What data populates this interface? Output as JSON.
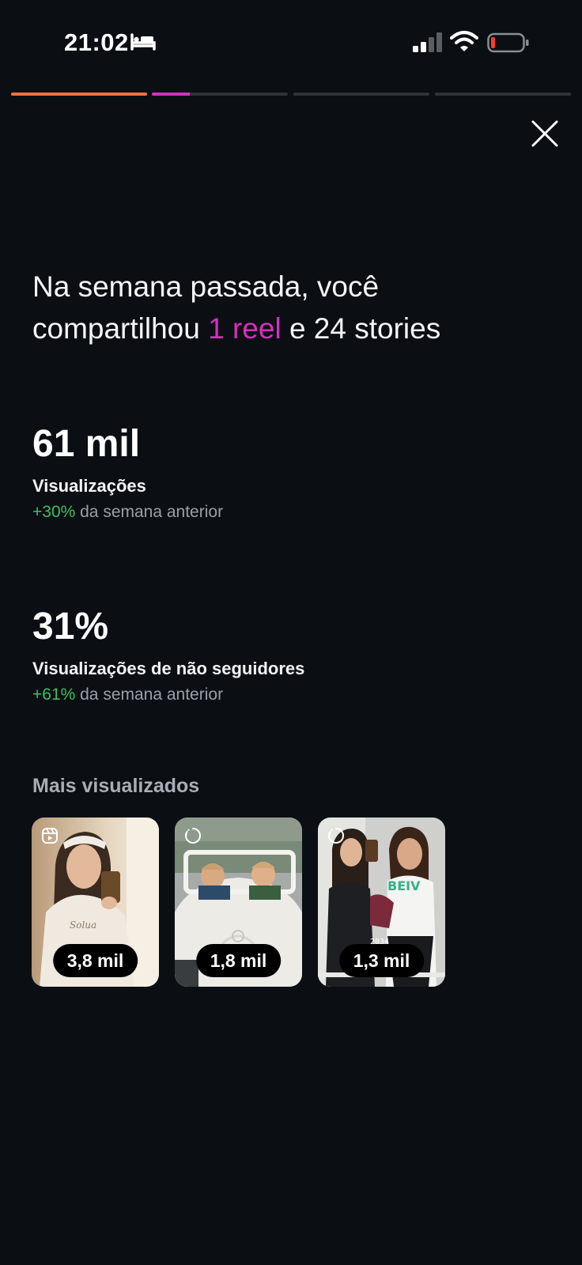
{
  "status_bar": {
    "time": "21:02",
    "icons": [
      "sleep-mode-icon",
      "cellular-signal-icon",
      "wifi-icon",
      "battery-low-icon"
    ]
  },
  "progress": {
    "segments": [
      {
        "fill": 1.0,
        "color": "#f0723a"
      },
      {
        "fill": 0.28,
        "color": "#d62fbf"
      },
      {
        "fill": 0.0,
        "color": "#2e333a"
      },
      {
        "fill": 0.0,
        "color": "#2e333a"
      }
    ]
  },
  "close_icon": "close-icon",
  "headline": {
    "part1": "Na semana passada, você compartilhou ",
    "highlight": "1 reel",
    "part2": " e 24 stories"
  },
  "metrics": [
    {
      "value": "61 mil",
      "label": "Visualizações",
      "change_pct": "+30%",
      "change_text": " da semana anterior"
    },
    {
      "value": "31%",
      "label": "Visualizações de não seguidores",
      "change_pct": "+61%",
      "change_text": " da semana anterior"
    }
  ],
  "most_viewed": {
    "title": "Mais visualizados",
    "items": [
      {
        "type_icon": "reel-icon",
        "views": "3,8 mil"
      },
      {
        "type_icon": "story-icon",
        "views": "1,8 mil"
      },
      {
        "type_icon": "story-icon",
        "views": "1,3 mil"
      }
    ]
  },
  "colors": {
    "background": "#0b0f14",
    "accent_pink": "#d62fbf",
    "accent_orange": "#f0723a",
    "positive_green": "#3fbf5a"
  }
}
